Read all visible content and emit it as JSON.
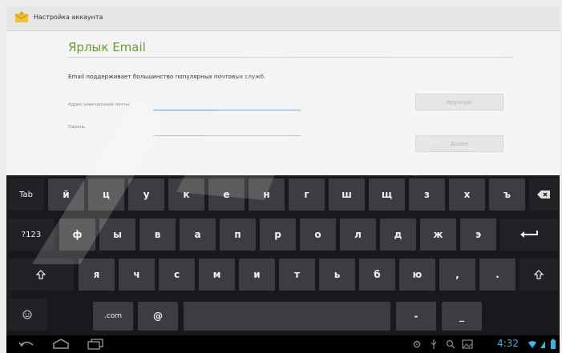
{
  "actionbar": {
    "title": "Настройка аккаунта"
  },
  "form": {
    "title": "Ярлык Email",
    "intro": "Email поддерживает большинство популярных почтовых служб.",
    "email_label": "Адрес электронной почты",
    "email_value": "",
    "password_label": "Пароль",
    "password_value": "",
    "manual_button": "Вручную",
    "next_button": "Далее"
  },
  "keyboard": {
    "row1": [
      "Tab",
      "й",
      "ц",
      "у",
      "к",
      "е",
      "н",
      "г",
      "ш",
      "щ",
      "з",
      "х",
      "ъ"
    ],
    "row2": [
      "?123",
      "ф",
      "ы",
      "в",
      "а",
      "п",
      "р",
      "о",
      "л",
      "д",
      "ж",
      "э"
    ],
    "row3": [
      "я",
      "ч",
      "с",
      "м",
      "и",
      "т",
      "ь",
      "б",
      "ю",
      ",",
      "."
    ],
    "com_key": ".com",
    "at_key": "@",
    "dash_key": "-",
    "underscore_key": "_"
  },
  "statusbar": {
    "time": "4:32"
  },
  "colors": {
    "accent_green": "#6e9b2f",
    "focus_blue": "#3fa9d8",
    "clock_blue": "#33b5e5",
    "keyboard_bg": "#17191c"
  }
}
